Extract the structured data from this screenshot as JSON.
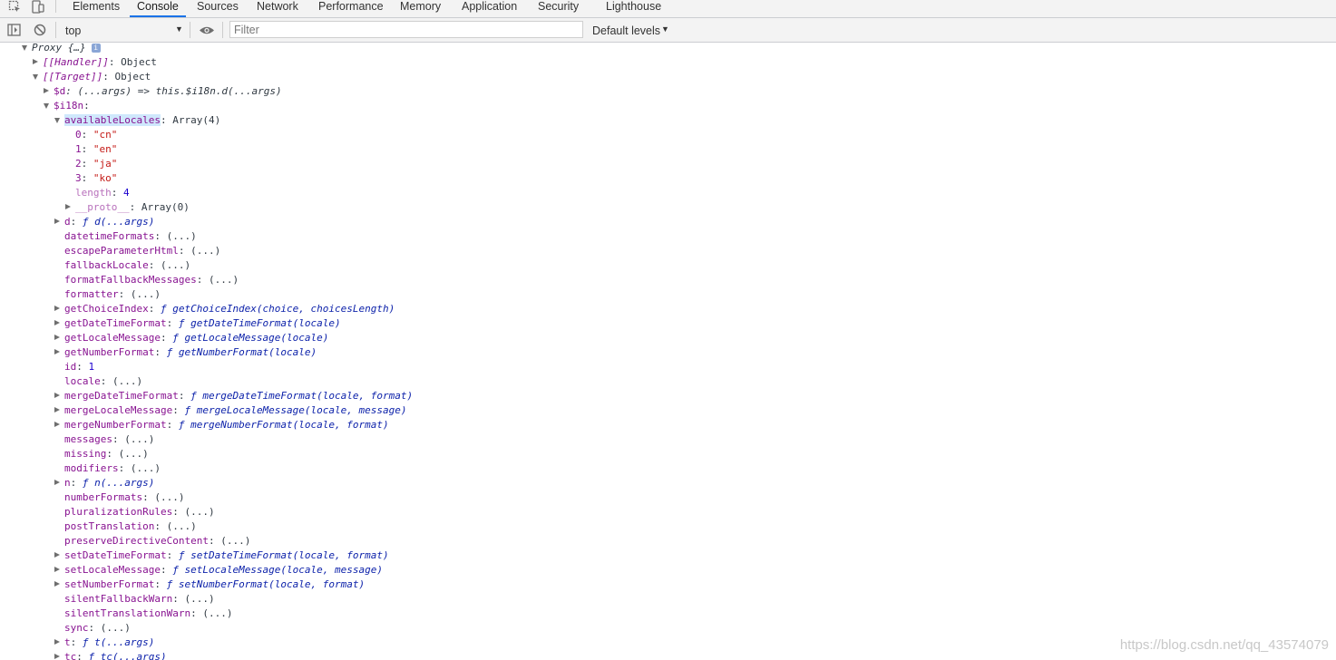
{
  "tabs": [
    "Elements",
    "Console",
    "Sources",
    "Network",
    "Performance",
    "Memory",
    "Application",
    "Security",
    "Lighthouse"
  ],
  "selected_tab": "Console",
  "toolbar": {
    "context": "top",
    "filter_placeholder": "Filter",
    "levels_label": "Default levels"
  },
  "colors": {
    "accent": "#1a73e8",
    "key": "#881391",
    "string": "#c41a16",
    "number": "#1c00cf"
  },
  "tree": [
    {
      "indent": 0,
      "toggle": "down",
      "parts": [
        {
          "t": "Proxy {…}",
          "c": "ital p"
        },
        {
          "badge": true
        }
      ]
    },
    {
      "indent": 1,
      "toggle": "right",
      "parts": [
        {
          "t": "[[Handler]]",
          "c": "k ital"
        },
        {
          "t": ": Object",
          "c": "p"
        }
      ]
    },
    {
      "indent": 1,
      "toggle": "down",
      "parts": [
        {
          "t": "[[Target]]",
          "c": "k ital"
        },
        {
          "t": ": Object",
          "c": "p"
        }
      ]
    },
    {
      "indent": 2,
      "toggle": "right",
      "parts": [
        {
          "t": "$d",
          "c": "k"
        },
        {
          "t": ": (...args) => this.$i18n.d(...args)",
          "c": "p ital"
        }
      ]
    },
    {
      "indent": 2,
      "toggle": "down",
      "parts": [
        {
          "t": "$i18n",
          "c": "k"
        },
        {
          "t": ":",
          "c": "p"
        }
      ]
    },
    {
      "indent": 3,
      "toggle": "down",
      "parts": [
        {
          "t": "availableLocales",
          "c": "kh"
        },
        {
          "t": ": Array(4)",
          "c": "p"
        }
      ]
    },
    {
      "indent": 4,
      "toggle": "",
      "parts": [
        {
          "t": "0",
          "c": "k"
        },
        {
          "t": ": ",
          "c": "p"
        },
        {
          "t": "\"cn\"",
          "c": "str"
        }
      ]
    },
    {
      "indent": 4,
      "toggle": "",
      "parts": [
        {
          "t": "1",
          "c": "k"
        },
        {
          "t": ": ",
          "c": "p"
        },
        {
          "t": "\"en\"",
          "c": "str"
        }
      ]
    },
    {
      "indent": 4,
      "toggle": "",
      "parts": [
        {
          "t": "2",
          "c": "k"
        },
        {
          "t": ": ",
          "c": "p"
        },
        {
          "t": "\"ja\"",
          "c": "str"
        }
      ]
    },
    {
      "indent": 4,
      "toggle": "",
      "parts": [
        {
          "t": "3",
          "c": "k"
        },
        {
          "t": ": ",
          "c": "p"
        },
        {
          "t": "\"ko\"",
          "c": "str"
        }
      ]
    },
    {
      "indent": 4,
      "toggle": "",
      "parts": [
        {
          "t": "length",
          "c": "k-dim"
        },
        {
          "t": ": ",
          "c": "p"
        },
        {
          "t": "4",
          "c": "num"
        }
      ]
    },
    {
      "indent": 4,
      "toggle": "right",
      "parts": [
        {
          "t": "__proto__",
          "c": "k-dim"
        },
        {
          "t": ": Array(0)",
          "c": "p"
        }
      ]
    },
    {
      "indent": 3,
      "toggle": "right",
      "parts": [
        {
          "t": "d",
          "c": "k"
        },
        {
          "t": ": ",
          "c": "p"
        },
        {
          "t": "ƒ d(...args)",
          "c": "fn"
        }
      ]
    },
    {
      "indent": 3,
      "toggle": "",
      "parts": [
        {
          "t": "datetimeFormats",
          "c": "k"
        },
        {
          "t": ": (...)",
          "c": "p"
        }
      ]
    },
    {
      "indent": 3,
      "toggle": "",
      "parts": [
        {
          "t": "escapeParameterHtml",
          "c": "k"
        },
        {
          "t": ": (...)",
          "c": "p"
        }
      ]
    },
    {
      "indent": 3,
      "toggle": "",
      "parts": [
        {
          "t": "fallbackLocale",
          "c": "k"
        },
        {
          "t": ": (...)",
          "c": "p"
        }
      ]
    },
    {
      "indent": 3,
      "toggle": "",
      "parts": [
        {
          "t": "formatFallbackMessages",
          "c": "k"
        },
        {
          "t": ": (...)",
          "c": "p"
        }
      ]
    },
    {
      "indent": 3,
      "toggle": "",
      "parts": [
        {
          "t": "formatter",
          "c": "k"
        },
        {
          "t": ": (...)",
          "c": "p"
        }
      ]
    },
    {
      "indent": 3,
      "toggle": "right",
      "parts": [
        {
          "t": "getChoiceIndex",
          "c": "k"
        },
        {
          "t": ": ",
          "c": "p"
        },
        {
          "t": "ƒ getChoiceIndex(choice, choicesLength)",
          "c": "fn"
        }
      ]
    },
    {
      "indent": 3,
      "toggle": "right",
      "parts": [
        {
          "t": "getDateTimeFormat",
          "c": "k"
        },
        {
          "t": ": ",
          "c": "p"
        },
        {
          "t": "ƒ getDateTimeFormat(locale)",
          "c": "fn"
        }
      ]
    },
    {
      "indent": 3,
      "toggle": "right",
      "parts": [
        {
          "t": "getLocaleMessage",
          "c": "k"
        },
        {
          "t": ": ",
          "c": "p"
        },
        {
          "t": "ƒ getLocaleMessage(locale)",
          "c": "fn"
        }
      ]
    },
    {
      "indent": 3,
      "toggle": "right",
      "parts": [
        {
          "t": "getNumberFormat",
          "c": "k"
        },
        {
          "t": ": ",
          "c": "p"
        },
        {
          "t": "ƒ getNumberFormat(locale)",
          "c": "fn"
        }
      ]
    },
    {
      "indent": 3,
      "toggle": "",
      "parts": [
        {
          "t": "id",
          "c": "k"
        },
        {
          "t": ": ",
          "c": "p"
        },
        {
          "t": "1",
          "c": "num"
        }
      ]
    },
    {
      "indent": 3,
      "toggle": "",
      "parts": [
        {
          "t": "locale",
          "c": "k"
        },
        {
          "t": ": (...)",
          "c": "p"
        }
      ]
    },
    {
      "indent": 3,
      "toggle": "right",
      "parts": [
        {
          "t": "mergeDateTimeFormat",
          "c": "k"
        },
        {
          "t": ": ",
          "c": "p"
        },
        {
          "t": "ƒ mergeDateTimeFormat(locale, format)",
          "c": "fn"
        }
      ]
    },
    {
      "indent": 3,
      "toggle": "right",
      "parts": [
        {
          "t": "mergeLocaleMessage",
          "c": "k"
        },
        {
          "t": ": ",
          "c": "p"
        },
        {
          "t": "ƒ mergeLocaleMessage(locale, message)",
          "c": "fn"
        }
      ]
    },
    {
      "indent": 3,
      "toggle": "right",
      "parts": [
        {
          "t": "mergeNumberFormat",
          "c": "k"
        },
        {
          "t": ": ",
          "c": "p"
        },
        {
          "t": "ƒ mergeNumberFormat(locale, format)",
          "c": "fn"
        }
      ]
    },
    {
      "indent": 3,
      "toggle": "",
      "parts": [
        {
          "t": "messages",
          "c": "k"
        },
        {
          "t": ": (...)",
          "c": "p"
        }
      ]
    },
    {
      "indent": 3,
      "toggle": "",
      "parts": [
        {
          "t": "missing",
          "c": "k"
        },
        {
          "t": ": (...)",
          "c": "p"
        }
      ]
    },
    {
      "indent": 3,
      "toggle": "",
      "parts": [
        {
          "t": "modifiers",
          "c": "k"
        },
        {
          "t": ": (...)",
          "c": "p"
        }
      ]
    },
    {
      "indent": 3,
      "toggle": "right",
      "parts": [
        {
          "t": "n",
          "c": "k"
        },
        {
          "t": ": ",
          "c": "p"
        },
        {
          "t": "ƒ n(...args)",
          "c": "fn"
        }
      ]
    },
    {
      "indent": 3,
      "toggle": "",
      "parts": [
        {
          "t": "numberFormats",
          "c": "k"
        },
        {
          "t": ": (...)",
          "c": "p"
        }
      ]
    },
    {
      "indent": 3,
      "toggle": "",
      "parts": [
        {
          "t": "pluralizationRules",
          "c": "k"
        },
        {
          "t": ": (...)",
          "c": "p"
        }
      ]
    },
    {
      "indent": 3,
      "toggle": "",
      "parts": [
        {
          "t": "postTranslation",
          "c": "k"
        },
        {
          "t": ": (...)",
          "c": "p"
        }
      ]
    },
    {
      "indent": 3,
      "toggle": "",
      "parts": [
        {
          "t": "preserveDirectiveContent",
          "c": "k"
        },
        {
          "t": ": (...)",
          "c": "p"
        }
      ]
    },
    {
      "indent": 3,
      "toggle": "right",
      "parts": [
        {
          "t": "setDateTimeFormat",
          "c": "k"
        },
        {
          "t": ": ",
          "c": "p"
        },
        {
          "t": "ƒ setDateTimeFormat(locale, format)",
          "c": "fn"
        }
      ]
    },
    {
      "indent": 3,
      "toggle": "right",
      "parts": [
        {
          "t": "setLocaleMessage",
          "c": "k"
        },
        {
          "t": ": ",
          "c": "p"
        },
        {
          "t": "ƒ setLocaleMessage(locale, message)",
          "c": "fn"
        }
      ]
    },
    {
      "indent": 3,
      "toggle": "right",
      "parts": [
        {
          "t": "setNumberFormat",
          "c": "k"
        },
        {
          "t": ": ",
          "c": "p"
        },
        {
          "t": "ƒ setNumberFormat(locale, format)",
          "c": "fn"
        }
      ]
    },
    {
      "indent": 3,
      "toggle": "",
      "parts": [
        {
          "t": "silentFallbackWarn",
          "c": "k"
        },
        {
          "t": ": (...)",
          "c": "p"
        }
      ]
    },
    {
      "indent": 3,
      "toggle": "",
      "parts": [
        {
          "t": "silentTranslationWarn",
          "c": "k"
        },
        {
          "t": ": (...)",
          "c": "p"
        }
      ]
    },
    {
      "indent": 3,
      "toggle": "",
      "parts": [
        {
          "t": "sync",
          "c": "k"
        },
        {
          "t": ": (...)",
          "c": "p"
        }
      ]
    },
    {
      "indent": 3,
      "toggle": "right",
      "parts": [
        {
          "t": "t",
          "c": "k"
        },
        {
          "t": ": ",
          "c": "p"
        },
        {
          "t": "ƒ t(...args)",
          "c": "fn"
        }
      ]
    },
    {
      "indent": 3,
      "toggle": "right",
      "parts": [
        {
          "t": "tc",
          "c": "k"
        },
        {
          "t": ": ",
          "c": "p"
        },
        {
          "t": "ƒ tc(...args)",
          "c": "fn"
        }
      ]
    }
  ],
  "watermark": "https://blog.csdn.net/qq_43574079"
}
